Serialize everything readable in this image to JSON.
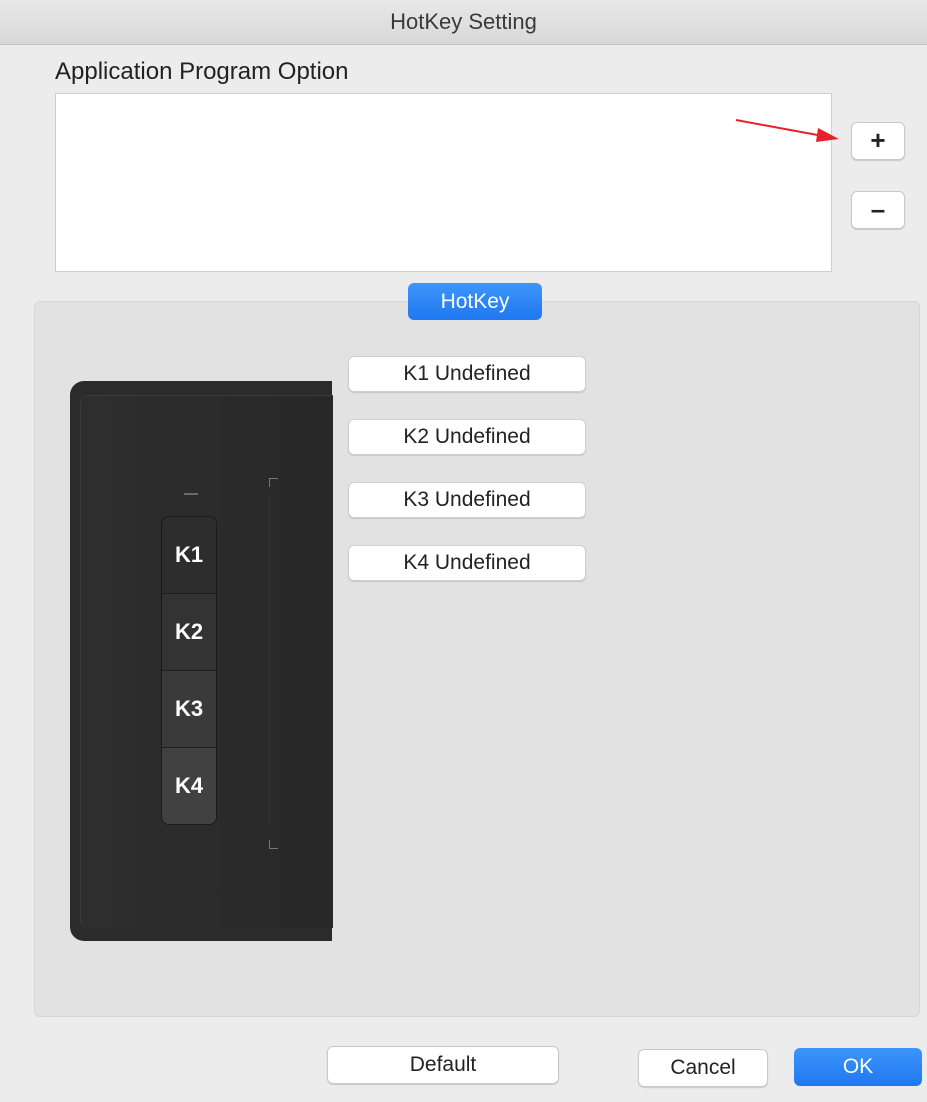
{
  "window": {
    "title": "HotKey Setting"
  },
  "app_option": {
    "label": "Application Program Option",
    "add_label": "+",
    "remove_label": "–"
  },
  "tab": {
    "label": "HotKey",
    "active_color": "#2a84f7"
  },
  "device": {
    "keys": [
      "K1",
      "K2",
      "K3",
      "K4"
    ]
  },
  "key_buttons": [
    "K1 Undefined",
    "K2 Undefined",
    "K3 Undefined",
    "K4 Undefined"
  ],
  "footer": {
    "default_label": "Default",
    "cancel_label": "Cancel",
    "ok_label": "OK"
  },
  "icons": {
    "annotation": "red-arrow-icon"
  },
  "colors": {
    "accent": "#2a84f7",
    "annotation": "#e8202a"
  }
}
